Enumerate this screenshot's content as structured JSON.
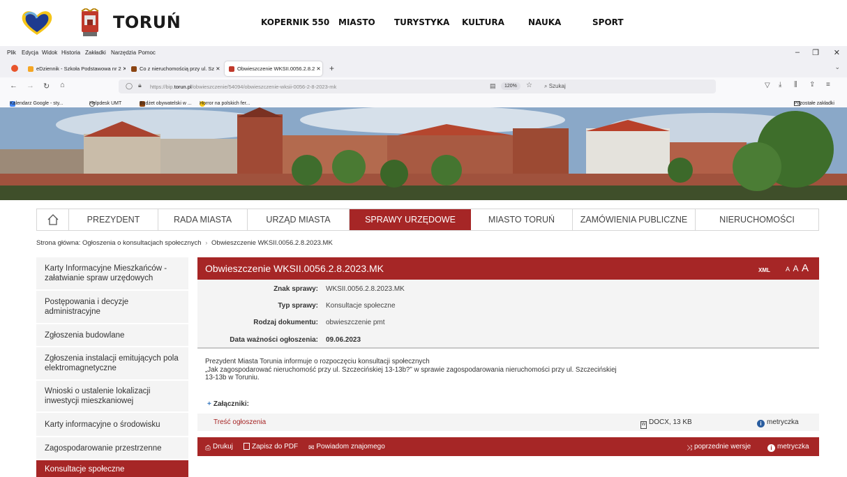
{
  "site": {
    "brand": "TORUŃ",
    "nav": [
      "KOPERNIK 550",
      "MIASTO",
      "TURYSTYKA",
      "KULTURA",
      "NAUKA",
      "SPORT"
    ]
  },
  "browser": {
    "menu": [
      "Plik",
      "Edycja",
      "Widok",
      "Historia",
      "Zakładki",
      "Narzędzia",
      "Pomoc"
    ],
    "tabs": [
      {
        "label": "eDziennik - Szkoła Podstawowa nr 2 ✕",
        "icon": "edziennik-icon"
      },
      {
        "label": "Co z nieruchomością przy ul. Sz ✕",
        "icon": "bookmark-icon"
      },
      {
        "label": "Obwieszczenie WKSII.0056.2.8.2 ✕",
        "icon": "torun-icon"
      }
    ],
    "new_tab": "+",
    "url_prefix": "https://bip.",
    "url_domain": "torun.pl",
    "url_rest": "/obwieszczenie/54094/obwieszczenie-wksii-0056-2-8-2023-mk",
    "zoom": "120%",
    "search_placeholder": "Szukaj",
    "bookmarks": [
      "Kalendarz Google - sty...",
      "Helpdesk UMT",
      "Budżet obywatelski w ...",
      "Horror na polskich fer..."
    ],
    "other_bookmarks": "Pozostałe zakładki"
  },
  "mainnav": [
    "PREZYDENT",
    "RADA MIASTA",
    "URZĄD MIASTA",
    "SPRAWY URZĘDOWE",
    "MIASTO TORUŃ",
    "ZAMÓWIENIA PUBLICZNE",
    "NIERUCHOMOŚCI"
  ],
  "breadcrumb": {
    "root": "Strona główna: Ogłoszenia o konsultacjach społecznych",
    "sep": "›",
    "current": "Obwieszczenie WKSII.0056.2.8.2023.MK"
  },
  "sidebar": [
    "Karty Informacyjne Mieszkańców - załatwianie spraw urzędowych",
    "Postępowania i decyzje administracyjne",
    "Zgłoszenia budowlane",
    "Zgłoszenia instalacji emitujących pola elektromagnetyczne",
    "Wnioski o ustalenie lokalizacji inwestycji mieszkaniowej",
    "Karty informacyjne o środowisku",
    "Zagospodarowanie przestrzenne",
    "Konsultacje społeczne"
  ],
  "content": {
    "title": "Obwieszczenie WKSII.0056.2.8.2023.MK",
    "xml": "XML",
    "font_sizes": [
      "A",
      "A",
      "A"
    ],
    "meta": [
      {
        "label": "Znak sprawy:",
        "value": "WKSII.0056.2.8.2023.MK"
      },
      {
        "label": "Typ sprawy:",
        "value": "Konsultacje społeczne"
      },
      {
        "label": "Rodzaj dokumentu:",
        "value": "obwieszczenie pmt"
      },
      {
        "label": "Data ważności ogłoszenia:",
        "value": "09.06.2023"
      }
    ],
    "desc_lines": [
      "Prezydent Miasta Torunia informuje o rozpoczęciu konsultacji społecznych",
      "„Jak zagospodarować nieruchomość przy ul. Szczecińskiej 13-13b?” w sprawie zagospodarowania nieruchomości przy ul. Szczecińskiej",
      "13-13b w Toruniu."
    ],
    "attachments_label": "Załączniki:",
    "attachment": {
      "name": "Treść ogłoszenia",
      "size": "DOCX, 13 KB",
      "meta": "metryczka"
    },
    "actions": {
      "print": "Drukuj",
      "pdf": "Zapisz do PDF",
      "notify": "Powiadom znajomego",
      "versions": "poprzednie wersje",
      "meta": "metryczka"
    }
  },
  "colors": {
    "accent": "#a62626",
    "sidebar_bg": "#f4f4f4"
  }
}
